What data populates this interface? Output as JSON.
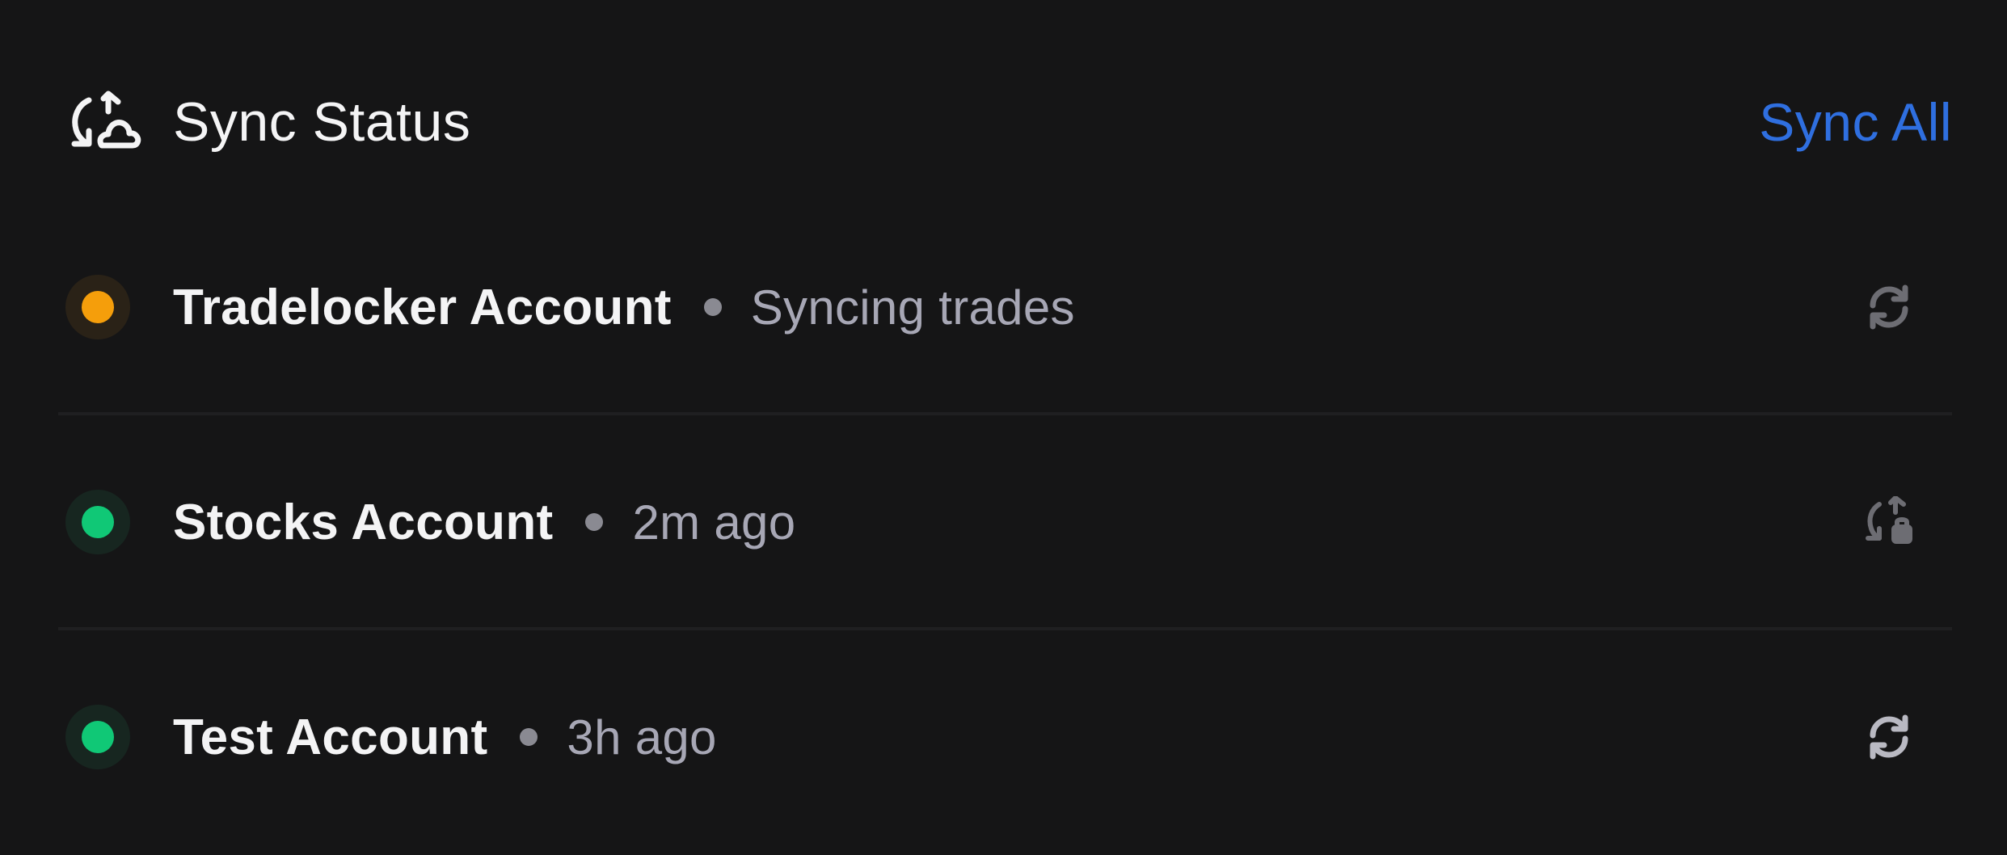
{
  "header": {
    "title": "Sync Status",
    "icon": "sync-cloud-icon",
    "action_label": "Sync All"
  },
  "colors": {
    "background": "#151516",
    "accent": "#2f6fe0",
    "syncing": "#f59e0b",
    "synced": "#10c876",
    "muted": "#a7a7b5"
  },
  "accounts": [
    {
      "name": "Tradelocker Account",
      "status": "Syncing trades",
      "state": "syncing",
      "action_icon": "refresh-icon"
    },
    {
      "name": "Stocks Account",
      "status": "2m ago",
      "state": "synced",
      "action_icon": "sync-locked-icon"
    },
    {
      "name": "Test Account",
      "status": "3h ago",
      "state": "synced",
      "action_icon": "refresh-icon"
    }
  ]
}
